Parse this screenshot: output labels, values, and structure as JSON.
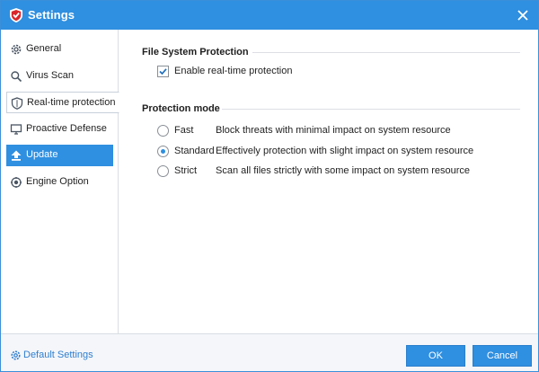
{
  "window": {
    "title": "Settings",
    "accent_color": "#2f8fe0"
  },
  "sidebar": {
    "items": [
      {
        "label": "General",
        "icon": "gear-icon"
      },
      {
        "label": "Virus Scan",
        "icon": "search-icon"
      },
      {
        "label": "Real-time protection",
        "icon": "shield-icon",
        "selected": true
      },
      {
        "label": "Proactive Defense",
        "icon": "monitor-icon"
      },
      {
        "label": "Update",
        "icon": "upload-arrow-icon",
        "highlighted": true
      },
      {
        "label": "Engine Option",
        "icon": "engine-gear-icon"
      }
    ]
  },
  "file_system_protection": {
    "title": "File System Protection",
    "enable_label": "Enable real-time protection",
    "enabled": true
  },
  "protection_mode": {
    "title": "Protection mode",
    "options": [
      {
        "name": "Fast",
        "description": "Block threats with minimal impact on system resource",
        "checked": false
      },
      {
        "name": "Standard",
        "description": "Effectively protection with slight impact on system resource",
        "checked": true
      },
      {
        "name": "Strict",
        "description": "Scan all files strictly with some impact on system resource",
        "checked": false
      }
    ]
  },
  "footer": {
    "default_settings_label": "Default Settings",
    "ok_label": "OK",
    "cancel_label": "Cancel"
  }
}
